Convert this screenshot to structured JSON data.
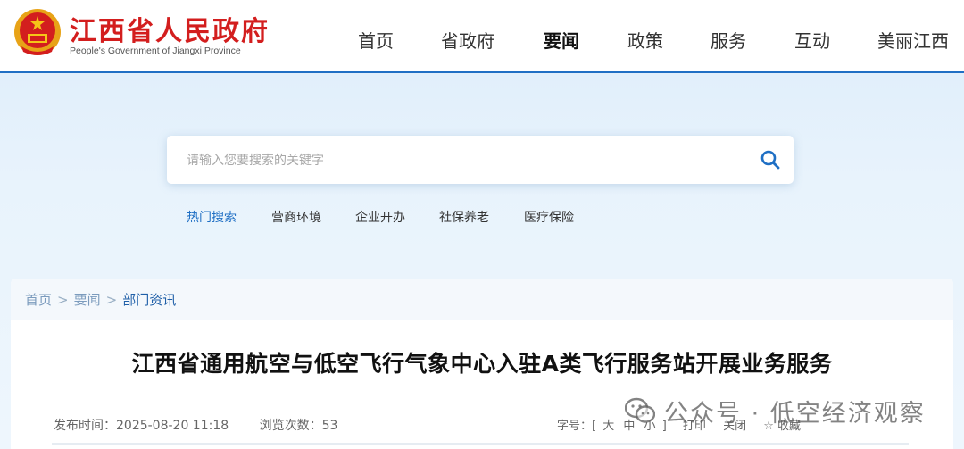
{
  "header": {
    "title": "江西省人民政府",
    "subtitle": "People's Government of Jiangxi Province",
    "nav": [
      "首页",
      "省政府",
      "要闻",
      "政策",
      "服务",
      "互动",
      "美丽江西"
    ],
    "active_nav": "要闻"
  },
  "search": {
    "placeholder": "请输入您要搜索的关键字",
    "hot_label": "热门搜索",
    "tags": [
      "营商环境",
      "企业开办",
      "社保养老",
      "医疗保险"
    ]
  },
  "breadcrumb": [
    "首页",
    "要闻",
    "部门资讯"
  ],
  "article": {
    "title": "江西省通用航空与低空飞行气象中心入驻A类飞行服务站开展业务服务",
    "publish_label": "发布时间：2025-08-20 11:18",
    "views_label": "浏览次数：53",
    "font_label": "字号：[",
    "font_large": "大",
    "font_medium": "中",
    "font_small": "小",
    "font_close": "]",
    "print": "打印",
    "close": "关闭",
    "favorite": "☆ 收藏"
  },
  "watermark": "公众号 · 低空经济观察",
  "colors": {
    "brand_red": "#d31e1e",
    "brand_blue": "#1f6fc4"
  }
}
